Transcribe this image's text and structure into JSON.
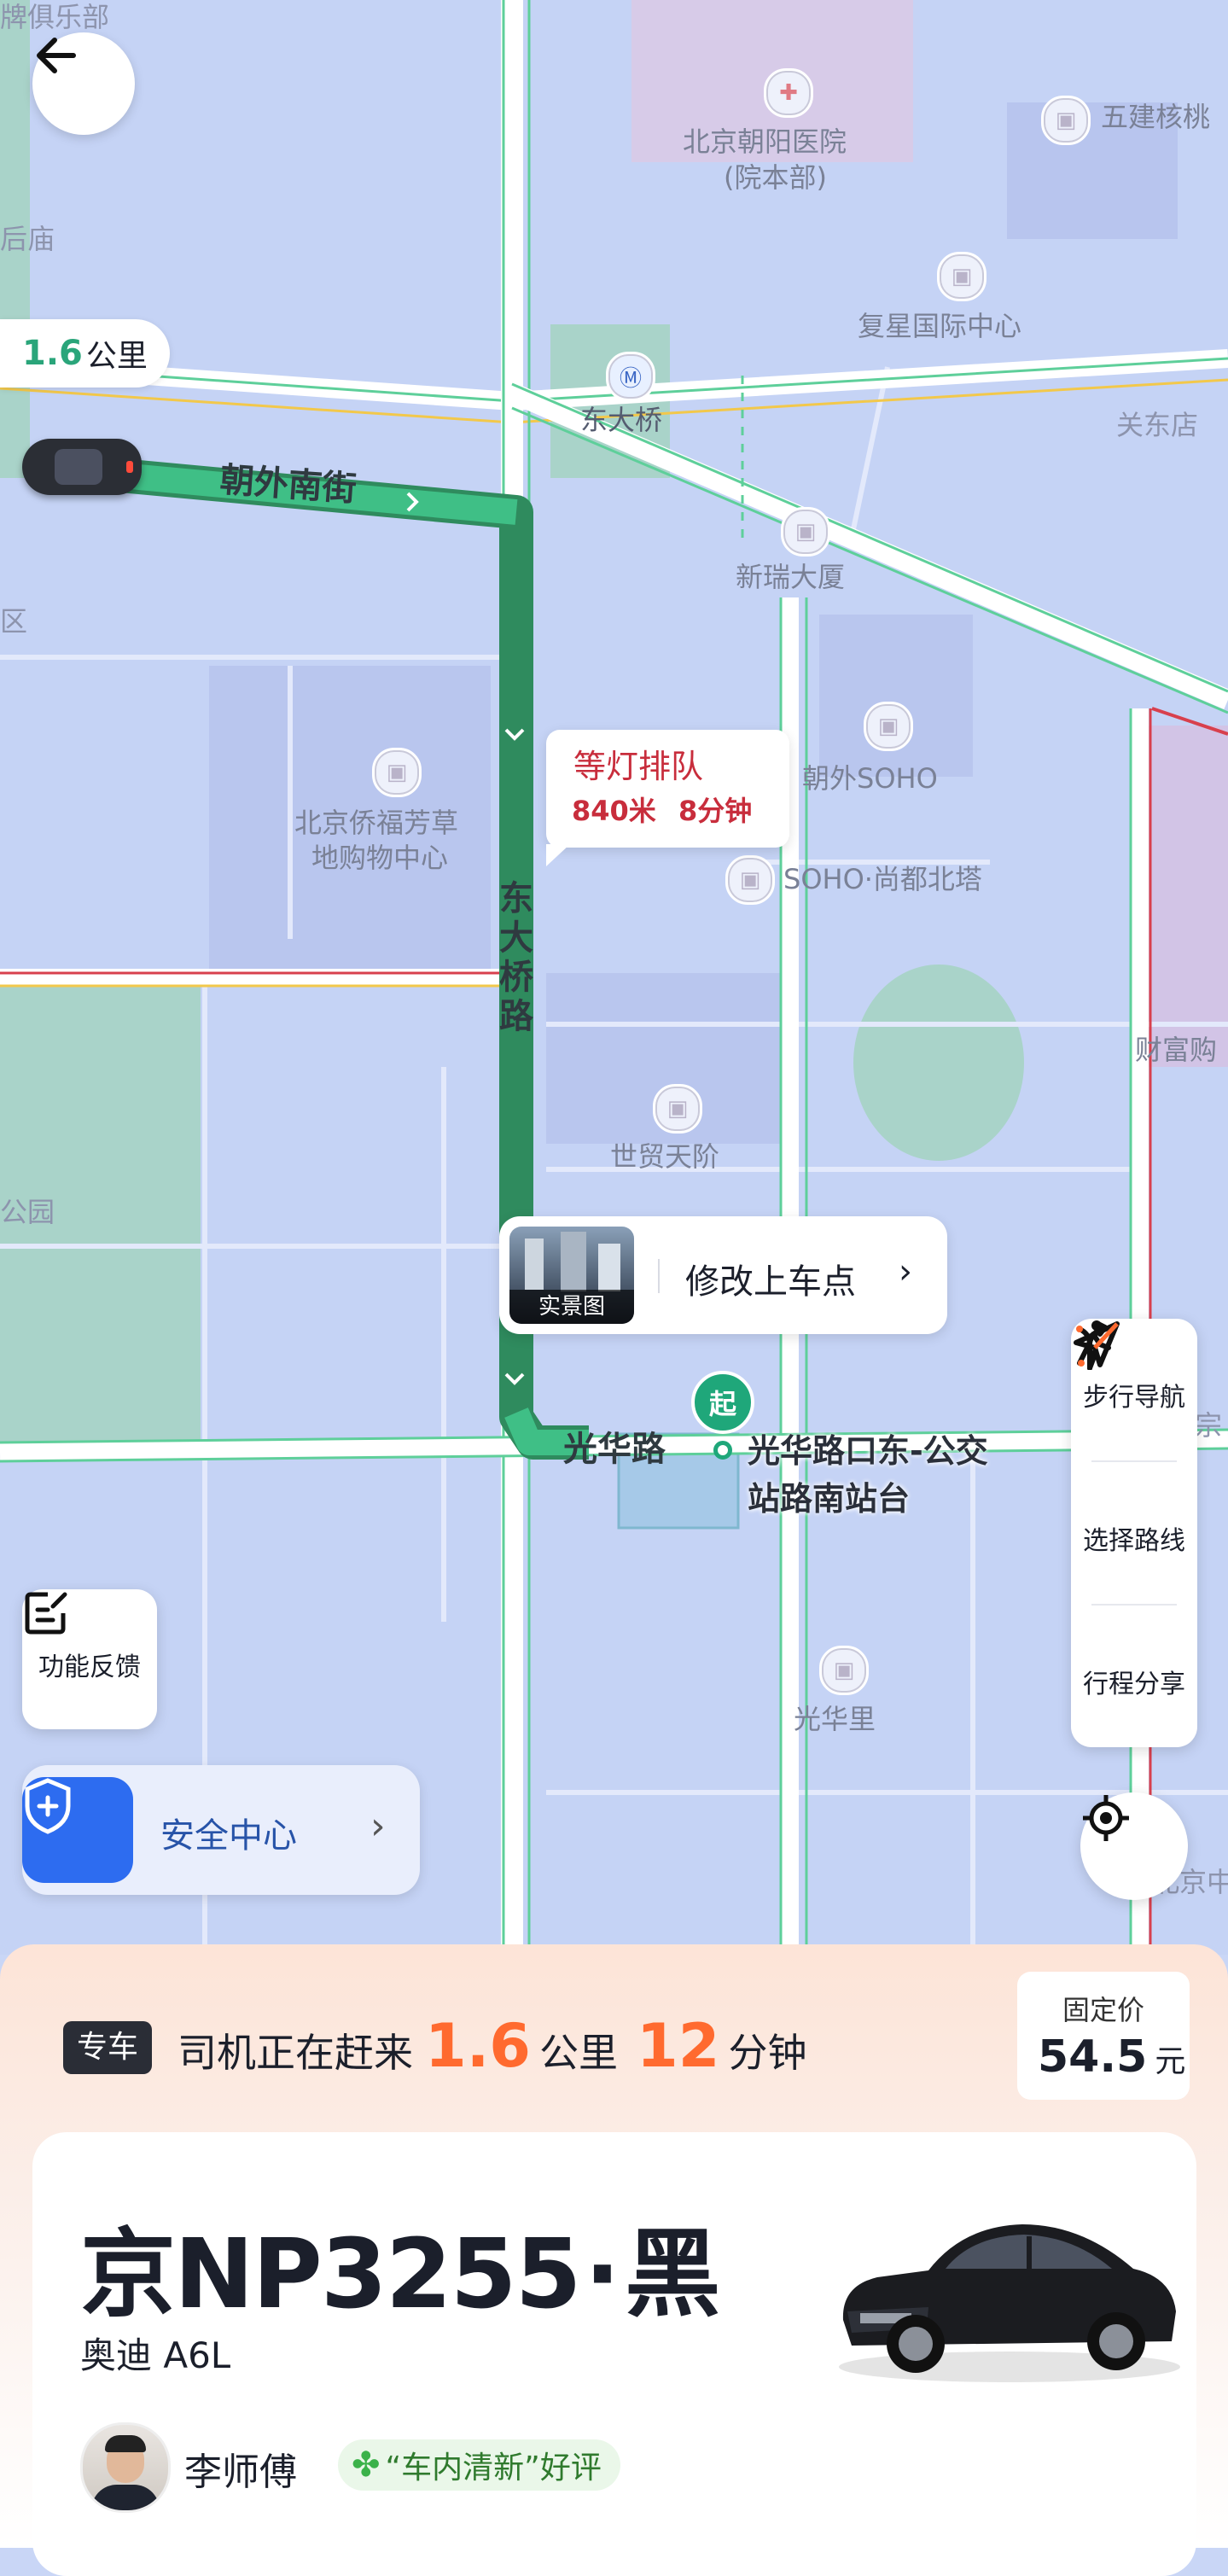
{
  "map": {
    "distance_chip": {
      "value": "1.6",
      "unit": "公里"
    },
    "roads": {
      "chaowai": "朝外南街",
      "dongdaqiao": "东大桥路",
      "guanghua": "光华路"
    },
    "pois": {
      "p1": "牌俱乐部",
      "p2": "北京朝阳医院",
      "p2b": "(院本部)",
      "p3": "五建核桃",
      "p4": "复星国际中心",
      "p5": "东大桥",
      "p6": "关东店",
      "p7": "新瑞大厦",
      "p8": "朝外SOHO",
      "p9": "北京侨福芳草",
      "p9b": "地购物中心",
      "p10": "SOHO·尚都北塔",
      "p11": "财富购",
      "p12": "世贸天阶",
      "p13": "光华里",
      "p14": "后庙",
      "p15": "区",
      "p16": "公园",
      "p17": "宗",
      "p18": "北京中"
    },
    "traffic_bubble": {
      "title": "等灯排队",
      "distance": "840米",
      "time": "8分钟"
    },
    "pickup": {
      "thumb_label": "实景图",
      "action": "修改上车点",
      "marker": "起",
      "stop_name_l1": "光华路口东-公交",
      "stop_name_l2": "站路南站台"
    },
    "side_tools": [
      {
        "label": "步行导航",
        "icon": "walk-icon"
      },
      {
        "label": "选择路线",
        "icon": "route-icon"
      },
      {
        "label": "行程分享",
        "icon": "share-icon"
      }
    ],
    "feedback_label": "功能反馈",
    "safety_label": "安全中心"
  },
  "trip": {
    "tag": "专车",
    "status_prefix": "司机正在赶来",
    "distance": "1.6",
    "distance_unit": "公里",
    "time": "12",
    "time_unit": "分钟",
    "price_label": "固定价",
    "price": "54.5",
    "price_unit": "元"
  },
  "car": {
    "plate": "京NP3255",
    "sep": "·",
    "color": "黑",
    "model": "奥迪 A6L",
    "driver": "李师傅",
    "review": "“车内清新”好评"
  },
  "colors": {
    "route_green": "#39b982",
    "route_red": "#d8404d",
    "accent_orange": "#ff6a2f",
    "safety_blue": "#2d6cf0"
  }
}
